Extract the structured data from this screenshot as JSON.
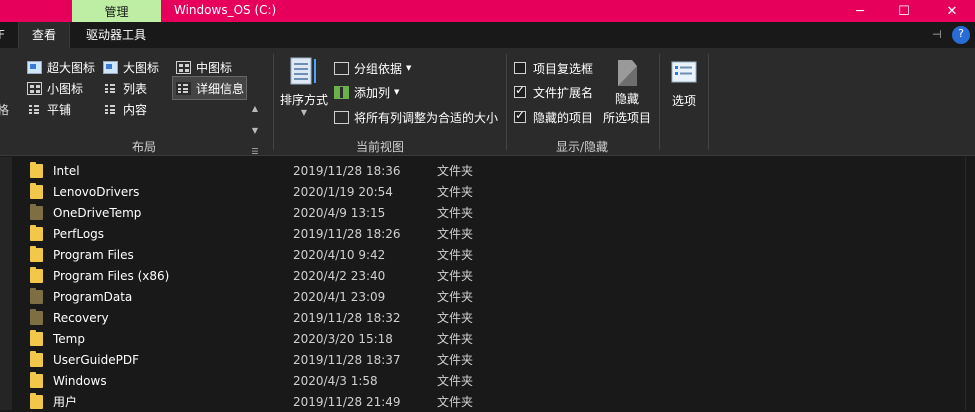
{
  "titlebar": {
    "context_tab": "管理",
    "window_title": "Windows_OS (C:)",
    "minimize": "─",
    "maximize": "☐",
    "close": "✕",
    "bg_color": "#e6005c"
  },
  "tabs": {
    "partial_left": "F",
    "view": "查看",
    "drive_tools": "驱动器工具",
    "pin": "⊣",
    "help": "?"
  },
  "ribbon": {
    "layout": {
      "partial_left": "格",
      "extra_large": "超大图标",
      "large": "大图标",
      "medium": "中图标",
      "small": "小图标",
      "list": "列表",
      "details": "详细信息",
      "tiles": "平铺",
      "content": "内容",
      "label": "布局"
    },
    "current_view": {
      "sort_by": "排序方式",
      "group_by": "分组依据",
      "add_column": "添加列",
      "fit_columns": "将所有列调整为合适的大小",
      "label": "当前视图"
    },
    "show_hide": {
      "item_checkboxes": "项目复选框",
      "item_checkboxes_checked": false,
      "file_extensions": "文件扩展名",
      "file_extensions_checked": true,
      "hidden_items": "隐藏的项目",
      "hidden_items_checked": true,
      "hide_selected_line1": "隐藏",
      "hide_selected_line2": "所选项目",
      "label": "显示/隐藏"
    },
    "options": "选项"
  },
  "files": [
    {
      "name": "Intel",
      "date": "2019/11/28 18:36",
      "type": "文件夹",
      "system": false
    },
    {
      "name": "LenovoDrivers",
      "date": "2020/1/19 20:54",
      "type": "文件夹",
      "system": false
    },
    {
      "name": "OneDriveTemp",
      "date": "2020/4/9 13:15",
      "type": "文件夹",
      "system": true
    },
    {
      "name": "PerfLogs",
      "date": "2019/11/28 18:26",
      "type": "文件夹",
      "system": false
    },
    {
      "name": "Program Files",
      "date": "2020/4/10 9:42",
      "type": "文件夹",
      "system": false
    },
    {
      "name": "Program Files (x86)",
      "date": "2020/4/2 23:40",
      "type": "文件夹",
      "system": false
    },
    {
      "name": "ProgramData",
      "date": "2020/4/1 23:09",
      "type": "文件夹",
      "system": true
    },
    {
      "name": "Recovery",
      "date": "2019/11/28 18:32",
      "type": "文件夹",
      "system": true
    },
    {
      "name": "Temp",
      "date": "2020/3/20 15:18",
      "type": "文件夹",
      "system": false
    },
    {
      "name": "UserGuidePDF",
      "date": "2019/11/28 18:37",
      "type": "文件夹",
      "system": false
    },
    {
      "name": "Windows",
      "date": "2020/4/3 1:58",
      "type": "文件夹",
      "system": false
    },
    {
      "name": "用户",
      "date": "2019/11/28 21:49",
      "type": "文件夹",
      "system": false
    }
  ]
}
